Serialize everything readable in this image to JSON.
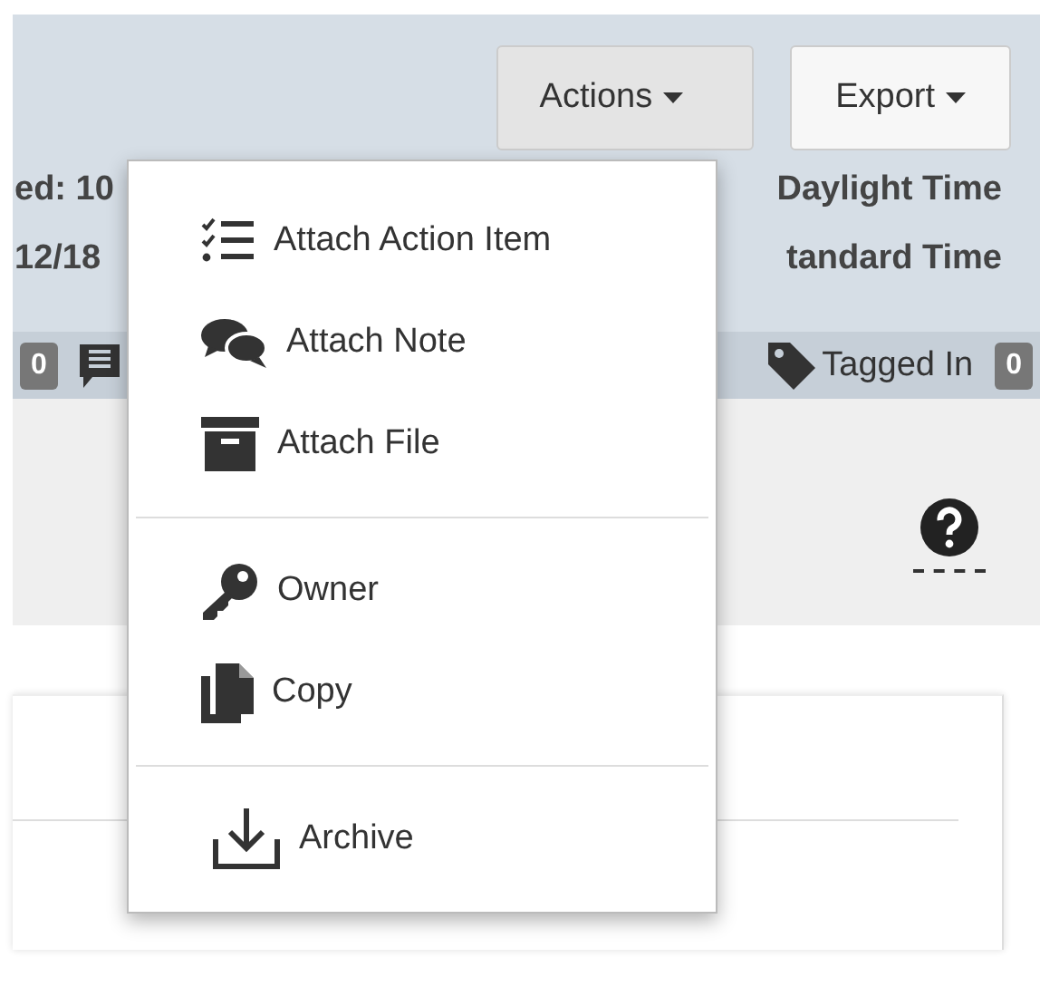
{
  "toolbar": {
    "buttons": [
      {
        "label": "Actions",
        "pressed": true
      },
      {
        "label": "Export",
        "pressed": false
      }
    ]
  },
  "info": {
    "left": [
      "ed: 10",
      "12/18"
    ],
    "right": [
      "Daylight Time",
      "tandard Time"
    ]
  },
  "counts": {
    "first_badge": "0",
    "tag_label": "Tagged In",
    "tag_badge": "0"
  },
  "menu": {
    "sections": [
      [
        {
          "label": "Attach Action Item"
        },
        {
          "label": "Attach Note"
        },
        {
          "label": "Attach File"
        }
      ],
      [
        {
          "label": "Owner"
        },
        {
          "label": "Copy"
        }
      ],
      [
        {
          "label": "Archive"
        }
      ]
    ]
  }
}
